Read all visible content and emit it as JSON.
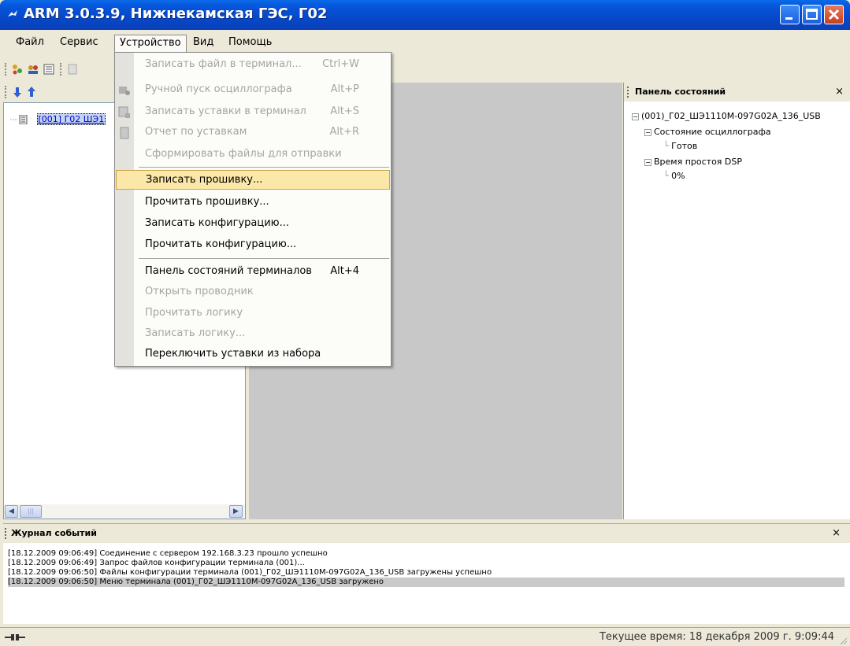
{
  "window": {
    "title": "ARM 3.0.3.9, Нижнекамская ГЭС, Г02"
  },
  "menubar": [
    "Файл",
    "Сервис",
    "Устройство",
    "Вид",
    "Помощь"
  ],
  "tree": {
    "item_label": "[001] Г02 ШЭ1"
  },
  "dropdown": {
    "items": [
      {
        "label": "Записать файл в терминал...",
        "shortcut": "Ctrl+W",
        "disabled": true
      },
      {
        "label": "Ручной пуск осциллографа",
        "shortcut": "Alt+P",
        "disabled": true
      },
      {
        "label": "Записать уставки в терминал",
        "shortcut": "Alt+S",
        "disabled": true
      },
      {
        "label": "Отчет по уставкам",
        "shortcut": "Alt+R",
        "disabled": true
      },
      {
        "label": "Сформировать файлы для отправки",
        "shortcut": "",
        "disabled": true
      },
      {
        "label": "Записать прошивку...",
        "shortcut": "",
        "disabled": false
      },
      {
        "label": "Прочитать прошивку...",
        "shortcut": "",
        "disabled": false
      },
      {
        "label": "Записать конфигурацию...",
        "shortcut": "",
        "disabled": false
      },
      {
        "label": "Прочитать конфигурацию...",
        "shortcut": "",
        "disabled": false
      },
      {
        "label": "Панель состояний терминалов",
        "shortcut": "Alt+4",
        "disabled": false
      },
      {
        "label": "Открыть проводник",
        "shortcut": "",
        "disabled": true
      },
      {
        "label": "Прочитать логику",
        "shortcut": "",
        "disabled": true
      },
      {
        "label": "Записать логику...",
        "shortcut": "",
        "disabled": true
      },
      {
        "label": "Переключить уставки из набора",
        "shortcut": "",
        "disabled": false
      }
    ]
  },
  "status_panel": {
    "title": "Панель состояний",
    "close": "×",
    "root": "(001)_Г02_ШЭ1110М-097G02A_136_USB",
    "node1": "Состояние осциллографа",
    "node1_value": "Готов",
    "node2": "Время простоя DSP",
    "node2_value": "0%"
  },
  "log": {
    "title": "Журнал событий",
    "close": "×",
    "lines": [
      "[18.12.2009 09:06:49] Соединение с сервером 192.168.3.23 прошло успешно",
      "[18.12.2009 09:06:49] Запрос файлов конфигурации терминала (001)...",
      "[18.12.2009 09:06:50] Файлы конфигурации терминала (001)_Г02_ШЭ1110М-097G02A_136_USB загружены успешно",
      "[18.12.2009 09:06:50] Меню терминала (001)_Г02_ШЭ1110М-097G02A_136_USB загружено"
    ]
  },
  "statusbar": {
    "time": "Текущее время: 18 декабря 2009 г. 9:09:44"
  },
  "colors": {
    "hover_bg": "#fbe8a8",
    "title_blue": "#0656dc"
  }
}
